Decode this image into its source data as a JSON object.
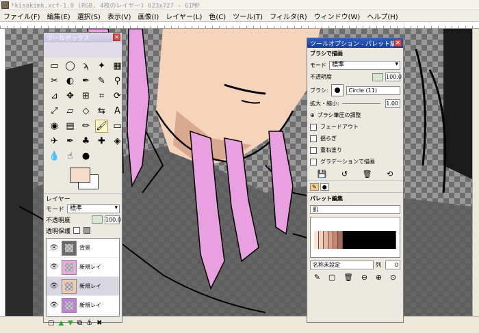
{
  "window": {
    "title": "*kisakimk.xcf-1.0 (RGB, 4枚のレイヤー) 623x727 - GIMP"
  },
  "menu": [
    "ファイル(F)",
    "編集(E)",
    "選択(S)",
    "表示(V)",
    "画像(I)",
    "レイヤー(L)",
    "色(C)",
    "ツール(T)",
    "フィルタ(R)",
    "ウィンドウ(W)",
    "ヘルプ(H)"
  ],
  "toolbox": {
    "title": "ツールボックス",
    "close_label": "✕",
    "tools": [
      "rect-select-icon",
      "ellipse-select-icon",
      "lasso-icon",
      "fuzzy-select-icon",
      "by-color-select-icon",
      "scissors-icon",
      "foreground-select-icon",
      "paths-icon",
      "color-picker-icon",
      "zoom-icon",
      "measure-icon",
      "move-icon",
      "align-icon",
      "crop-icon",
      "rotate-icon",
      "scale-icon",
      "shear-icon",
      "perspective-icon",
      "flip-icon",
      "text-icon",
      "bucket-fill-icon",
      "blend-icon",
      "pencil-icon",
      "paintbrush-icon",
      "eraser-icon",
      "airbrush-icon",
      "ink-icon",
      "clone-icon",
      "heal-icon",
      "perspective-clone-icon",
      "blur-icon",
      "smudge-icon",
      "dodge-burn-icon"
    ],
    "tool_glyphs": [
      "▭",
      "◯",
      "ϡ",
      "✦",
      "▦",
      "✂",
      "◐",
      "✒",
      "✎",
      "⚲",
      "⊿",
      "✥",
      "⊞",
      "⌗",
      "⟳",
      "⤢",
      "▱",
      "◇",
      "⇆",
      "A",
      "◉",
      "▤",
      "✏",
      "🖌",
      "▭",
      "✈",
      "✒",
      "♣",
      "✚",
      "◈",
      "💧",
      "☝",
      "●"
    ],
    "selected_tool_index": 23,
    "fg_color": "#f6dcc8",
    "bg_color": "#ffffff"
  },
  "layers": {
    "title": "レイヤー",
    "mode_label": "モード",
    "mode_value": "標準",
    "opacity_label": "不透明度",
    "opacity_value": "100.0",
    "lock_label": "透明保護",
    "items": [
      {
        "name": "背景",
        "thumb_color": "#6a6a6a"
      },
      {
        "name": "新規レイ",
        "thumb_color": "#e8a8e0"
      },
      {
        "name": "新規レイ",
        "thumb_color": "#f0c8b0"
      },
      {
        "name": "新規レイ",
        "thumb_color": "#c080e0"
      }
    ],
    "selected_index": 2,
    "buttons": [
      "new-layer-icon",
      "raise-icon",
      "lower-icon",
      "duplicate-icon",
      "anchor-icon",
      "delete-icon"
    ]
  },
  "tool_options": {
    "title": "ツールオプション - パレット編集",
    "tool_name": "ブラシで描画",
    "mode_label": "モード",
    "mode_value": "標準",
    "opacity_label": "不透明度",
    "opacity_value": "100.0",
    "brush_label": "ブラシ:",
    "brush_value": "Circle (11)",
    "scale_label": "拡大・縮小:",
    "scale_value": "1.00",
    "pressure_label": "ブラシ筆圧の調整",
    "options": [
      "フェードアウト",
      "揺らぎ",
      "重ね塗り",
      "グラデーションで描画"
    ]
  },
  "palette_editor": {
    "title": "パレット編集",
    "palette_name": "肌",
    "swatches": [
      "#fbe2d2",
      "#f5cfbb",
      "#eab8a0",
      "#dca088",
      "#c8866c",
      "#a86a58"
    ],
    "name_label": "名称未設定",
    "columns_label": "列",
    "columns_value": "0"
  }
}
